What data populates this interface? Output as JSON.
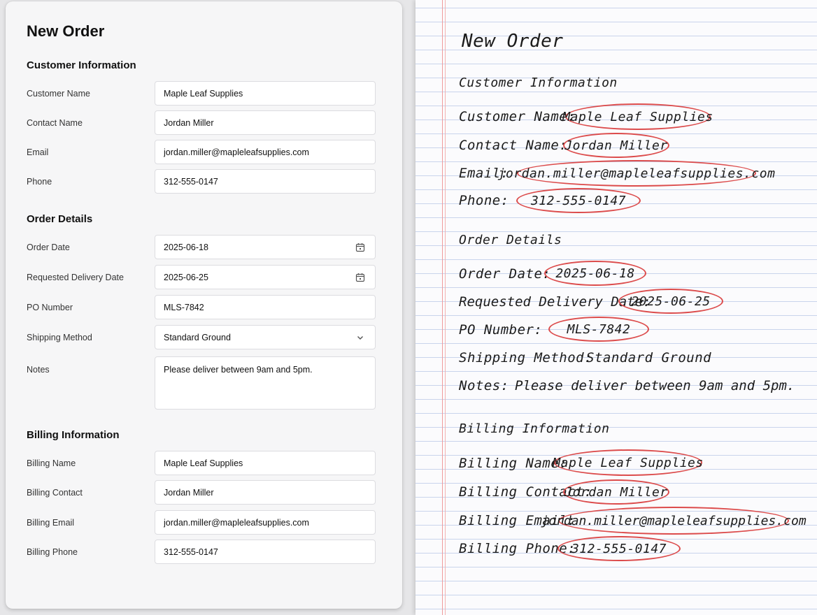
{
  "form": {
    "title": "New Order",
    "customer_section": "Customer Information",
    "order_section": "Order Details",
    "billing_section": "Billing Information",
    "fields": {
      "customer_name": {
        "label": "Customer Name",
        "value": "Maple Leaf Supplies"
      },
      "contact_name": {
        "label": "Contact Name",
        "value": "Jordan Miller"
      },
      "email": {
        "label": "Email",
        "value": "jordan.miller@mapleleafsupplies.com"
      },
      "phone": {
        "label": "Phone",
        "value": "312-555-0147"
      },
      "order_date": {
        "label": "Order Date",
        "value": "2025-06-18"
      },
      "delivery_date": {
        "label": "Requested Delivery Date",
        "value": "2025-06-25"
      },
      "po_number": {
        "label": "PO Number",
        "value": "MLS-7842"
      },
      "shipping_method": {
        "label": "Shipping Method",
        "value": "Standard Ground"
      },
      "notes": {
        "label": "Notes",
        "value": "Please deliver between 9am and 5pm."
      },
      "billing_name": {
        "label": "Billing Name",
        "value": "Maple Leaf Supplies"
      },
      "billing_contact": {
        "label": "Billing Contact",
        "value": "Jordan Miller"
      },
      "billing_email": {
        "label": "Billing Email",
        "value": "jordan.miller@mapleleafsupplies.com"
      },
      "billing_phone": {
        "label": "Billing Phone",
        "value": "312-555-0147"
      }
    }
  },
  "notebook": {
    "title": "New Order",
    "customer_section": "Customer Information",
    "order_section": "Order Details",
    "billing_section": "Billing Information",
    "lines": {
      "customer_name": {
        "label": "Customer Name:",
        "value": "Maple Leaf Supplies"
      },
      "contact_name": {
        "label": "Contact Name:",
        "value": "Jordan Miller"
      },
      "email": {
        "label": "Email:",
        "value": "jordan.miller@mapleleafsupplies.com"
      },
      "phone": {
        "label": "Phone:",
        "value": "312-555-0147"
      },
      "order_date": {
        "label": "Order Date:",
        "value": "2025-06-18"
      },
      "delivery_date": {
        "label": "Requested Delivery Date:",
        "value": "2025-06-25"
      },
      "po_number": {
        "label": "PO Number:",
        "value": "MLS-7842"
      },
      "shipping_method": {
        "label": "Shipping Method:",
        "value": "Standard Ground"
      },
      "notes": {
        "label": "Notes:",
        "value": "Please deliver between 9am and 5pm."
      },
      "billing_name": {
        "label": "Billing Name:",
        "value": "Maple Leaf Supplies"
      },
      "billing_contact": {
        "label": "Billing Contact:",
        "value": "Jordan Miller"
      },
      "billing_email": {
        "label": "Billing Email:",
        "value": "jordan.miller@mapleleafsupplies.com"
      },
      "billing_phone": {
        "label": "Billing Phone:",
        "value": "312-555-0147"
      }
    }
  },
  "icons": {
    "date_picker": "calendar-icon",
    "dropdown": "chevron-down-icon"
  },
  "colors": {
    "highlight_circle": "#dc4b4b",
    "notebook_margin": "#ef9b9b",
    "notebook_rule": "#c9d4ec"
  }
}
